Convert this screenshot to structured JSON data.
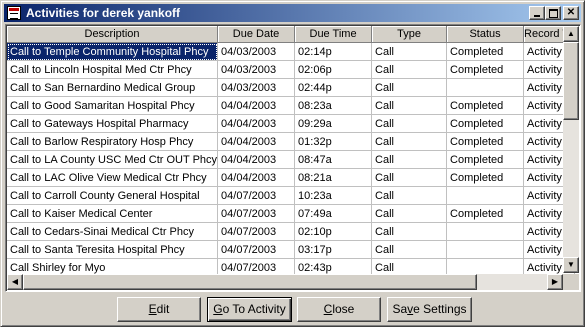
{
  "window": {
    "title": "Activities for derek yankoff"
  },
  "columns": [
    "Description",
    "Due Date",
    "Due Time",
    "Type",
    "Status",
    "Record Ty"
  ],
  "rows": [
    [
      "Call to Temple Community Hospital Phcy",
      "04/03/2003",
      "02:14p",
      "Call",
      "Completed",
      "Activity"
    ],
    [
      "Call to Lincoln Hospital Med Ctr Phcy",
      "04/03/2003",
      "02:06p",
      "Call",
      "Completed",
      "Activity"
    ],
    [
      "Call to San Bernardino Medical Group",
      "04/03/2003",
      "02:44p",
      "Call",
      "",
      "Activity"
    ],
    [
      "Call to Good Samaritan Hospital Phcy",
      "04/04/2003",
      "08:23a",
      "Call",
      "Completed",
      "Activity"
    ],
    [
      "Call to Gateways Hospital Pharmacy",
      "04/04/2003",
      "09:29a",
      "Call",
      "Completed",
      "Activity"
    ],
    [
      "Call to Barlow Respiratory Hosp Phcy",
      "04/04/2003",
      "01:32p",
      "Call",
      "Completed",
      "Activity"
    ],
    [
      "Call to LA County USC Med Ctr OUT Phcy",
      "04/04/2003",
      "08:47a",
      "Call",
      "Completed",
      "Activity"
    ],
    [
      "Call to LAC Olive View Medical Ctr Phcy",
      "04/04/2003",
      "08:21a",
      "Call",
      "Completed",
      "Activity"
    ],
    [
      "Call to Carroll County General Hospital",
      "04/07/2003",
      "10:23a",
      "Call",
      "",
      "Activity"
    ],
    [
      "Call to Kaiser Medical Center",
      "04/07/2003",
      "07:49a",
      "Call",
      "Completed",
      "Activity"
    ],
    [
      "Call to Cedars-Sinai Medical Ctr Phcy",
      "04/07/2003",
      "02:10p",
      "Call",
      "",
      "Activity"
    ],
    [
      "Call to Santa Teresita Hospital Phcy",
      "04/07/2003",
      "03:17p",
      "Call",
      "",
      "Activity"
    ],
    [
      "Call Shirley for Myo",
      "04/07/2003",
      "02:43p",
      "Call",
      "",
      "Activity"
    ]
  ],
  "buttons": {
    "edit": {
      "mnemonic": "E",
      "rest": "dit"
    },
    "goto": {
      "mnemonic": "G",
      "rest": "o To Activity"
    },
    "close": {
      "pre": "",
      "mnemonic": "C",
      "rest": "lose"
    },
    "save": {
      "pre": "Sa",
      "mnemonic": "v",
      "rest": "e Settings"
    }
  },
  "icons": {
    "minimize": "minimize-icon",
    "maximize": "maximize-icon",
    "close": "✕",
    "scroll_up": "▲",
    "scroll_down": "▼",
    "scroll_left": "◀",
    "scroll_right": "▶"
  },
  "colors": {
    "titlebar_start": "#0a246a",
    "titlebar_end": "#a6caf0",
    "selection": "#0a246a"
  }
}
